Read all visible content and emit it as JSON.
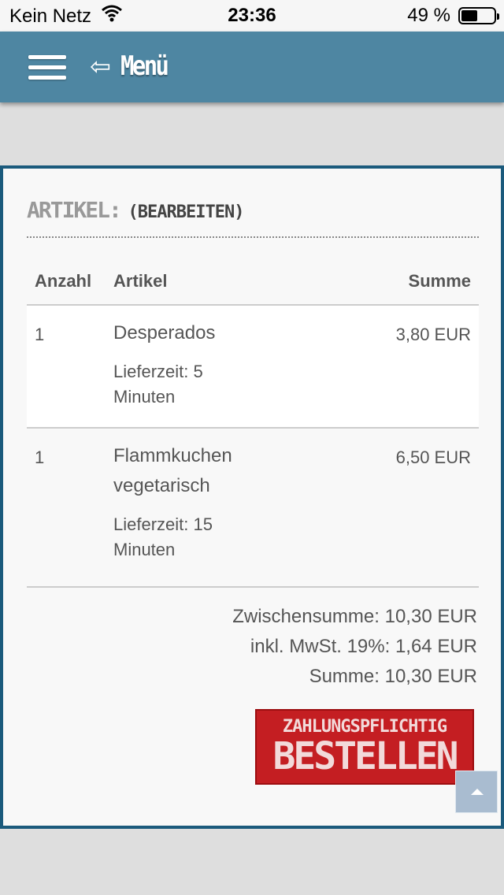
{
  "status_bar": {
    "carrier": "Kein Netz",
    "time": "23:36",
    "battery_text": "49 %",
    "battery_level": 0.49
  },
  "navbar": {
    "back_label": "Menü",
    "icons": [
      "hamburger-menu-icon",
      "back-arrow-icon"
    ],
    "color": "#4e86a2"
  },
  "cart": {
    "title": "ARTIKEL:",
    "edit_label": "(BEARBEITEN)",
    "columns": {
      "qty": "Anzahl",
      "item": "Artikel",
      "sum": "Summe"
    },
    "items": [
      {
        "qty": "1",
        "name": "Desperados",
        "delivery": "Lieferzeit: 5 Minuten",
        "sum": "3,80 EUR"
      },
      {
        "qty": "1",
        "name": "Flammkuchen vegetarisch",
        "delivery": "Lieferzeit: 15 Minuten",
        "sum": "6,50 EUR"
      }
    ],
    "subtotal": "Zwischensumme: 10,30 EUR",
    "vat": "inkl. MwSt. 19%: 1,64 EUR",
    "total": "Summe: 10,30 EUR"
  },
  "order_button": {
    "line1": "ZAHLUNGSPFLICHTIG",
    "line2": "BESTELLEN",
    "color": "#c41e22"
  },
  "accent_color": "#1b5a7c"
}
